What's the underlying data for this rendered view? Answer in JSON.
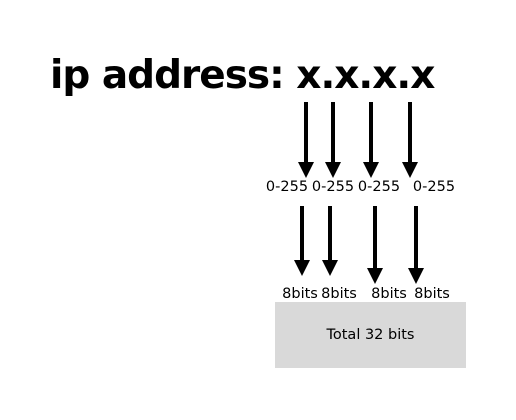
{
  "title": "ip address: x.x.x.x",
  "ranges": [
    "0-255",
    "0-255",
    "0-255",
    "0-255"
  ],
  "bits": [
    "8bits",
    "8bits",
    "8bits",
    "8bits"
  ],
  "total": "Total 32 bits",
  "colors": {
    "background": "#ffffff",
    "text": "#000000",
    "arrow": "#000000",
    "total_box": "#d9d9d9"
  }
}
